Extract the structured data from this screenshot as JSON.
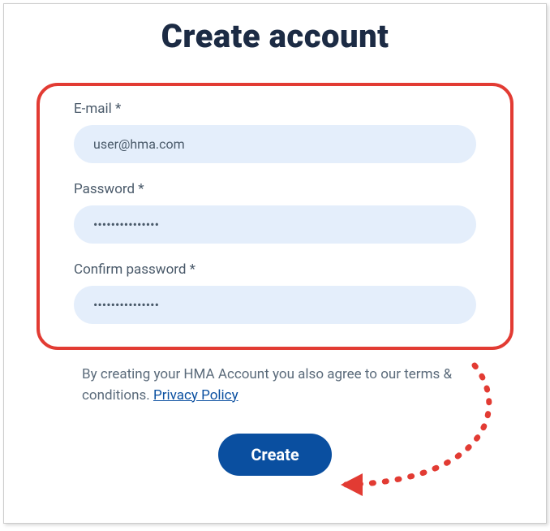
{
  "title": "Create account",
  "form": {
    "email": {
      "label": "E-mail *",
      "value": "user@hma.com"
    },
    "password": {
      "label": "Password *",
      "value": "•••••••••••••••"
    },
    "confirm": {
      "label": "Confirm password *",
      "value": "•••••••••••••••"
    }
  },
  "consent": {
    "text_prefix": "By creating your HMA Account you also agree to our terms & conditions. ",
    "link_label": "Privacy Policy"
  },
  "button": {
    "create_label": "Create"
  },
  "colors": {
    "accent": "#0a4fa0",
    "highlight": "#e23b33",
    "input_bg": "#e4eefb"
  }
}
